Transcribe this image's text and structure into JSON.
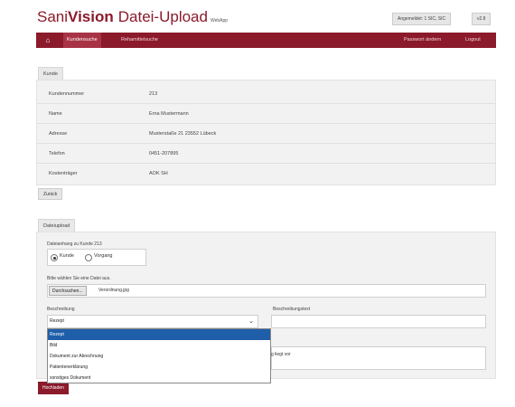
{
  "brand": {
    "part1": "Sani",
    "part2": "Vision",
    "title": "Datei-Upload",
    "sub": "WebApp"
  },
  "status": {
    "logged_in": "Angemeldet: 1 SIC, SIC",
    "version": "v2.8"
  },
  "nav": {
    "items": [
      "Kundensuche",
      "Rehamittelsuche"
    ],
    "right": [
      "Passwort ändern",
      "Logout"
    ]
  },
  "customer": {
    "tab": "Kunde",
    "rows": [
      {
        "label": "Kundennummer",
        "value": "213"
      },
      {
        "label": "Name",
        "value": "Erna  Mustermann"
      },
      {
        "label": "Adresse",
        "value": "Musterstaße 21  23552  Lübeck"
      },
      {
        "label": "Telefon",
        "value": "0451-207895"
      },
      {
        "label": "Kostenträger",
        "value": "AOK SH"
      }
    ],
    "back_button": "Zurück"
  },
  "upload": {
    "tab": "Dateiupload",
    "attach_label": "Dateianhang zu Kunde 213",
    "radio": [
      {
        "label": "Kunde",
        "checked": true
      },
      {
        "label": "Vorgang",
        "checked": false
      }
    ],
    "file_prompt": "Bitte wählen Sie eine Datei aus.",
    "browse_button": "Durchsuchen...",
    "file_name": "Verordnung.jpg",
    "desc_label": "Beschreibung",
    "desc_text_label": "Beschreibungstext",
    "select_value": "Rezept",
    "options": [
      "Rezept",
      "Bild",
      "Dokument zur Abrechnung",
      "Patientenerklärung",
      "sonstiges Dokument"
    ],
    "selected_index": 0,
    "hidden_text": "g liegt vor",
    "upload_button": "Hochladen"
  }
}
